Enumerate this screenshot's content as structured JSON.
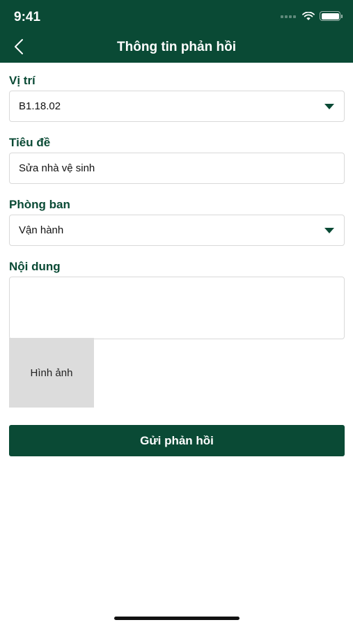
{
  "status_bar": {
    "time": "9:41"
  },
  "header": {
    "title": "Thông tin phản hồi"
  },
  "form": {
    "location": {
      "label": "Vị trí",
      "value": "B1.18.02"
    },
    "subject": {
      "label": "Tiêu đề",
      "value": "Sửa nhà vệ sinh"
    },
    "department": {
      "label": "Phòng ban",
      "value": "Vận hành"
    },
    "content": {
      "label": "Nội dung",
      "value": ""
    }
  },
  "image_picker": {
    "label": "Hình ảnh"
  },
  "submit": {
    "label": "Gửi phản hồi"
  },
  "colors": {
    "primary": "#0a4a35",
    "image_bg": "#dcdcdc",
    "border": "#d9d9d9"
  }
}
